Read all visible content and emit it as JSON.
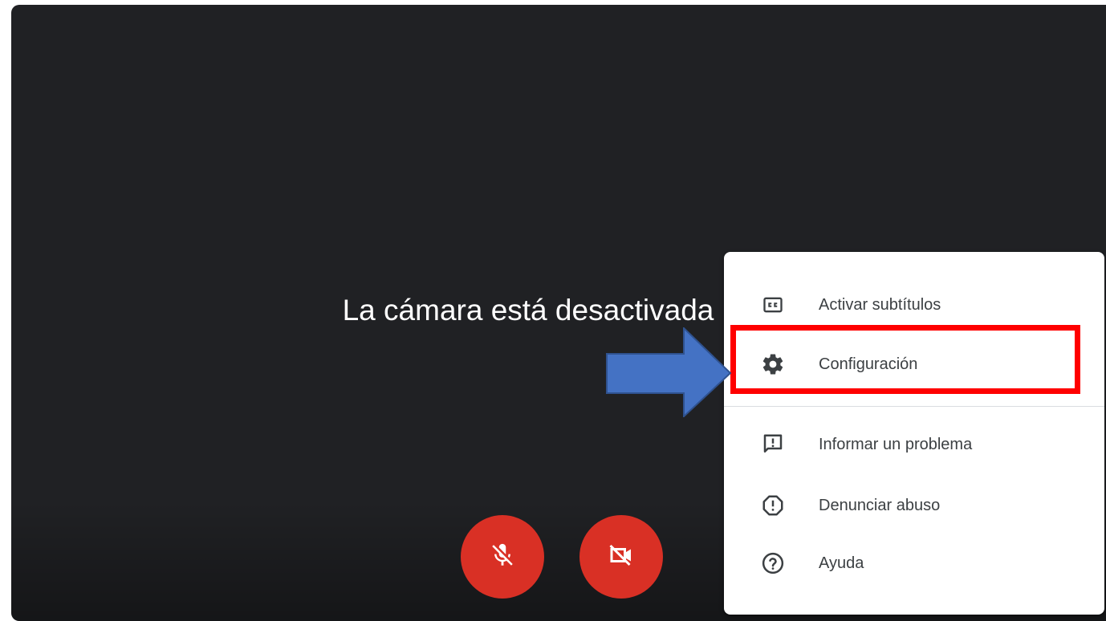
{
  "preview": {
    "camera_message": "La cámara está desactivada"
  },
  "controls": {
    "mic_icon": "mic-off-icon",
    "camera_icon": "videocam-off-icon",
    "button_color": "#d93025"
  },
  "menu": {
    "items": [
      {
        "icon": "closed-caption-icon",
        "label": "Activar subtítulos"
      },
      {
        "icon": "gear-icon",
        "label": "Configuración"
      },
      {
        "icon": "feedback-icon",
        "label": "Informar un problema"
      },
      {
        "icon": "report-icon",
        "label": "Denunciar abuso"
      },
      {
        "icon": "help-icon",
        "label": "Ayuda"
      }
    ]
  },
  "annotations": {
    "highlight_color": "#ff0000",
    "arrow_color": "#4472c4"
  }
}
